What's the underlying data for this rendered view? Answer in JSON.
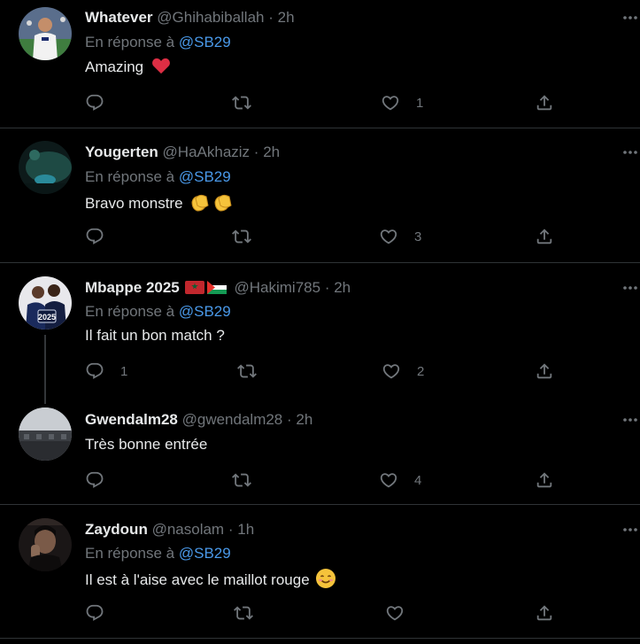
{
  "colors": {
    "background": "#000000",
    "text_primary": "#e7e9ea",
    "text_secondary": "#71767b",
    "mention": "#4a99e9",
    "divider": "#2f3336",
    "heart": "#f91880"
  },
  "tweets": [
    {
      "name": "Whatever",
      "handle": "@Ghihabiballah",
      "separator": "·",
      "time": "2h",
      "reply_prefix": "En réponse à",
      "reply_to": "@SB29",
      "text": "Amazing",
      "emoji": "red-heart-icon",
      "reply_count": "",
      "retweet_count": "",
      "like_count": "1"
    },
    {
      "name": "Yougerten",
      "handle": "@HaAkhaziz",
      "separator": "·",
      "time": "2h",
      "reply_prefix": "En réponse à",
      "reply_to": "@SB29",
      "text": "Bravo monstre",
      "emoji": "clapping-hands-icon",
      "reply_count": "",
      "retweet_count": "",
      "like_count": "3"
    },
    {
      "name": "Mbappe 2025",
      "flags": [
        "morocco-flag-icon",
        "palestine-flag-icon"
      ],
      "handle": "@Hakimi785",
      "separator": "·",
      "time": "2h",
      "reply_prefix": "En réponse à",
      "reply_to": "@SB29",
      "text": "Il fait un bon match ?",
      "reply_count": "1",
      "retweet_count": "",
      "like_count": "2"
    },
    {
      "name": "Gwendalm28",
      "handle": "@gwendalm28",
      "separator": "·",
      "time": "2h",
      "text": "Très bonne entrée",
      "reply_count": "",
      "retweet_count": "",
      "like_count": "4"
    },
    {
      "name": "Zaydoun",
      "handle": "@nasolam",
      "separator": "·",
      "time": "1h",
      "reply_prefix": "En réponse à",
      "reply_to": "@SB29",
      "text": "Il est à l'aise avec le maillot rouge",
      "emoji": "smiling-face-icon",
      "reply_count": "",
      "retweet_count": "",
      "like_count": ""
    }
  ]
}
